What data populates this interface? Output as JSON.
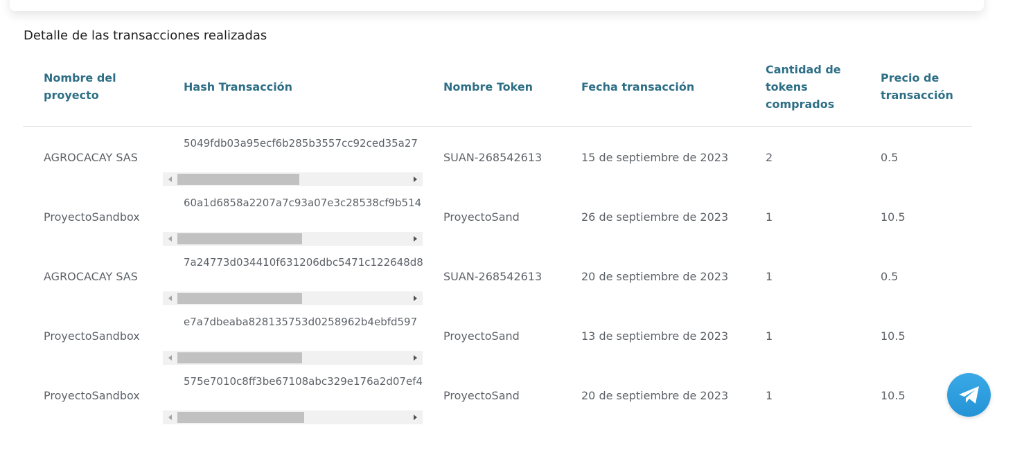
{
  "section_title": "Detalle de las transacciones realizadas",
  "columns": {
    "project": "Nombre del proyecto",
    "hash": "Hash Transacción",
    "token": "Nombre Token",
    "date": "Fecha transacción",
    "qty": "Cantidad de tokens comprados",
    "price": "Precio de transacción"
  },
  "rows": [
    {
      "project": "AGROCACAY SAS",
      "hash": "5049fdb03a95ecf6b285b3557cc92ced35a27",
      "token": "SUAN-268542613",
      "date": "15 de septiembre de 2023",
      "qty": "2",
      "price": "0.5",
      "scroll_fraction": 0.53
    },
    {
      "project": "ProyectoSandbox",
      "hash": "60a1d6858a2207a7c93a07e3c28538cf9b514",
      "token": "ProyectoSand",
      "date": "26 de septiembre de 2023",
      "qty": "1",
      "price": "10.5",
      "scroll_fraction": 0.54
    },
    {
      "project": "AGROCACAY SAS",
      "hash": "7a24773d034410f631206dbc5471c122648d8",
      "token": "SUAN-268542613",
      "date": "20 de septiembre de 2023",
      "qty": "1",
      "price": "0.5",
      "scroll_fraction": 0.54
    },
    {
      "project": "ProyectoSandbox",
      "hash": "e7a7dbeaba828135753d0258962b4ebfd597",
      "token": "ProyectoSand",
      "date": "13 de septiembre de 2023",
      "qty": "1",
      "price": "10.5",
      "scroll_fraction": 0.54
    },
    {
      "project": "ProyectoSandbox",
      "hash": "575e7010c8ff3be67108abc329e176a2d07ef4",
      "token": "ProyectoSand",
      "date": "20 de septiembre de 2023",
      "qty": "1",
      "price": "10.5",
      "scroll_fraction": 0.55
    }
  ],
  "telegram": {
    "icon": "telegram-icon",
    "color": "#2e9fe0"
  }
}
